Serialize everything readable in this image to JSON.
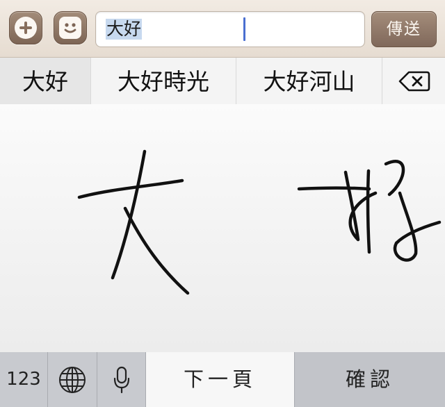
{
  "message_bar": {
    "input_value": "大好",
    "send_label": "傳送",
    "plus_icon": "plus-icon",
    "emoji_icon": "smiley-icon"
  },
  "candidates": {
    "items": [
      "大好",
      "大好時光",
      "大好河山"
    ],
    "backspace_icon": "backspace-icon"
  },
  "handwriting": {
    "strokes_text": "大好"
  },
  "bottom_bar": {
    "numbers_label": "123",
    "globe_icon": "globe-icon",
    "mic_icon": "microphone-icon",
    "next_page_label": "下一頁",
    "confirm_label": "確認"
  },
  "colors": {
    "accent_brown": "#8a7261",
    "selection_blue": "#c7d9ef",
    "caret_blue": "#4a6fd0"
  }
}
